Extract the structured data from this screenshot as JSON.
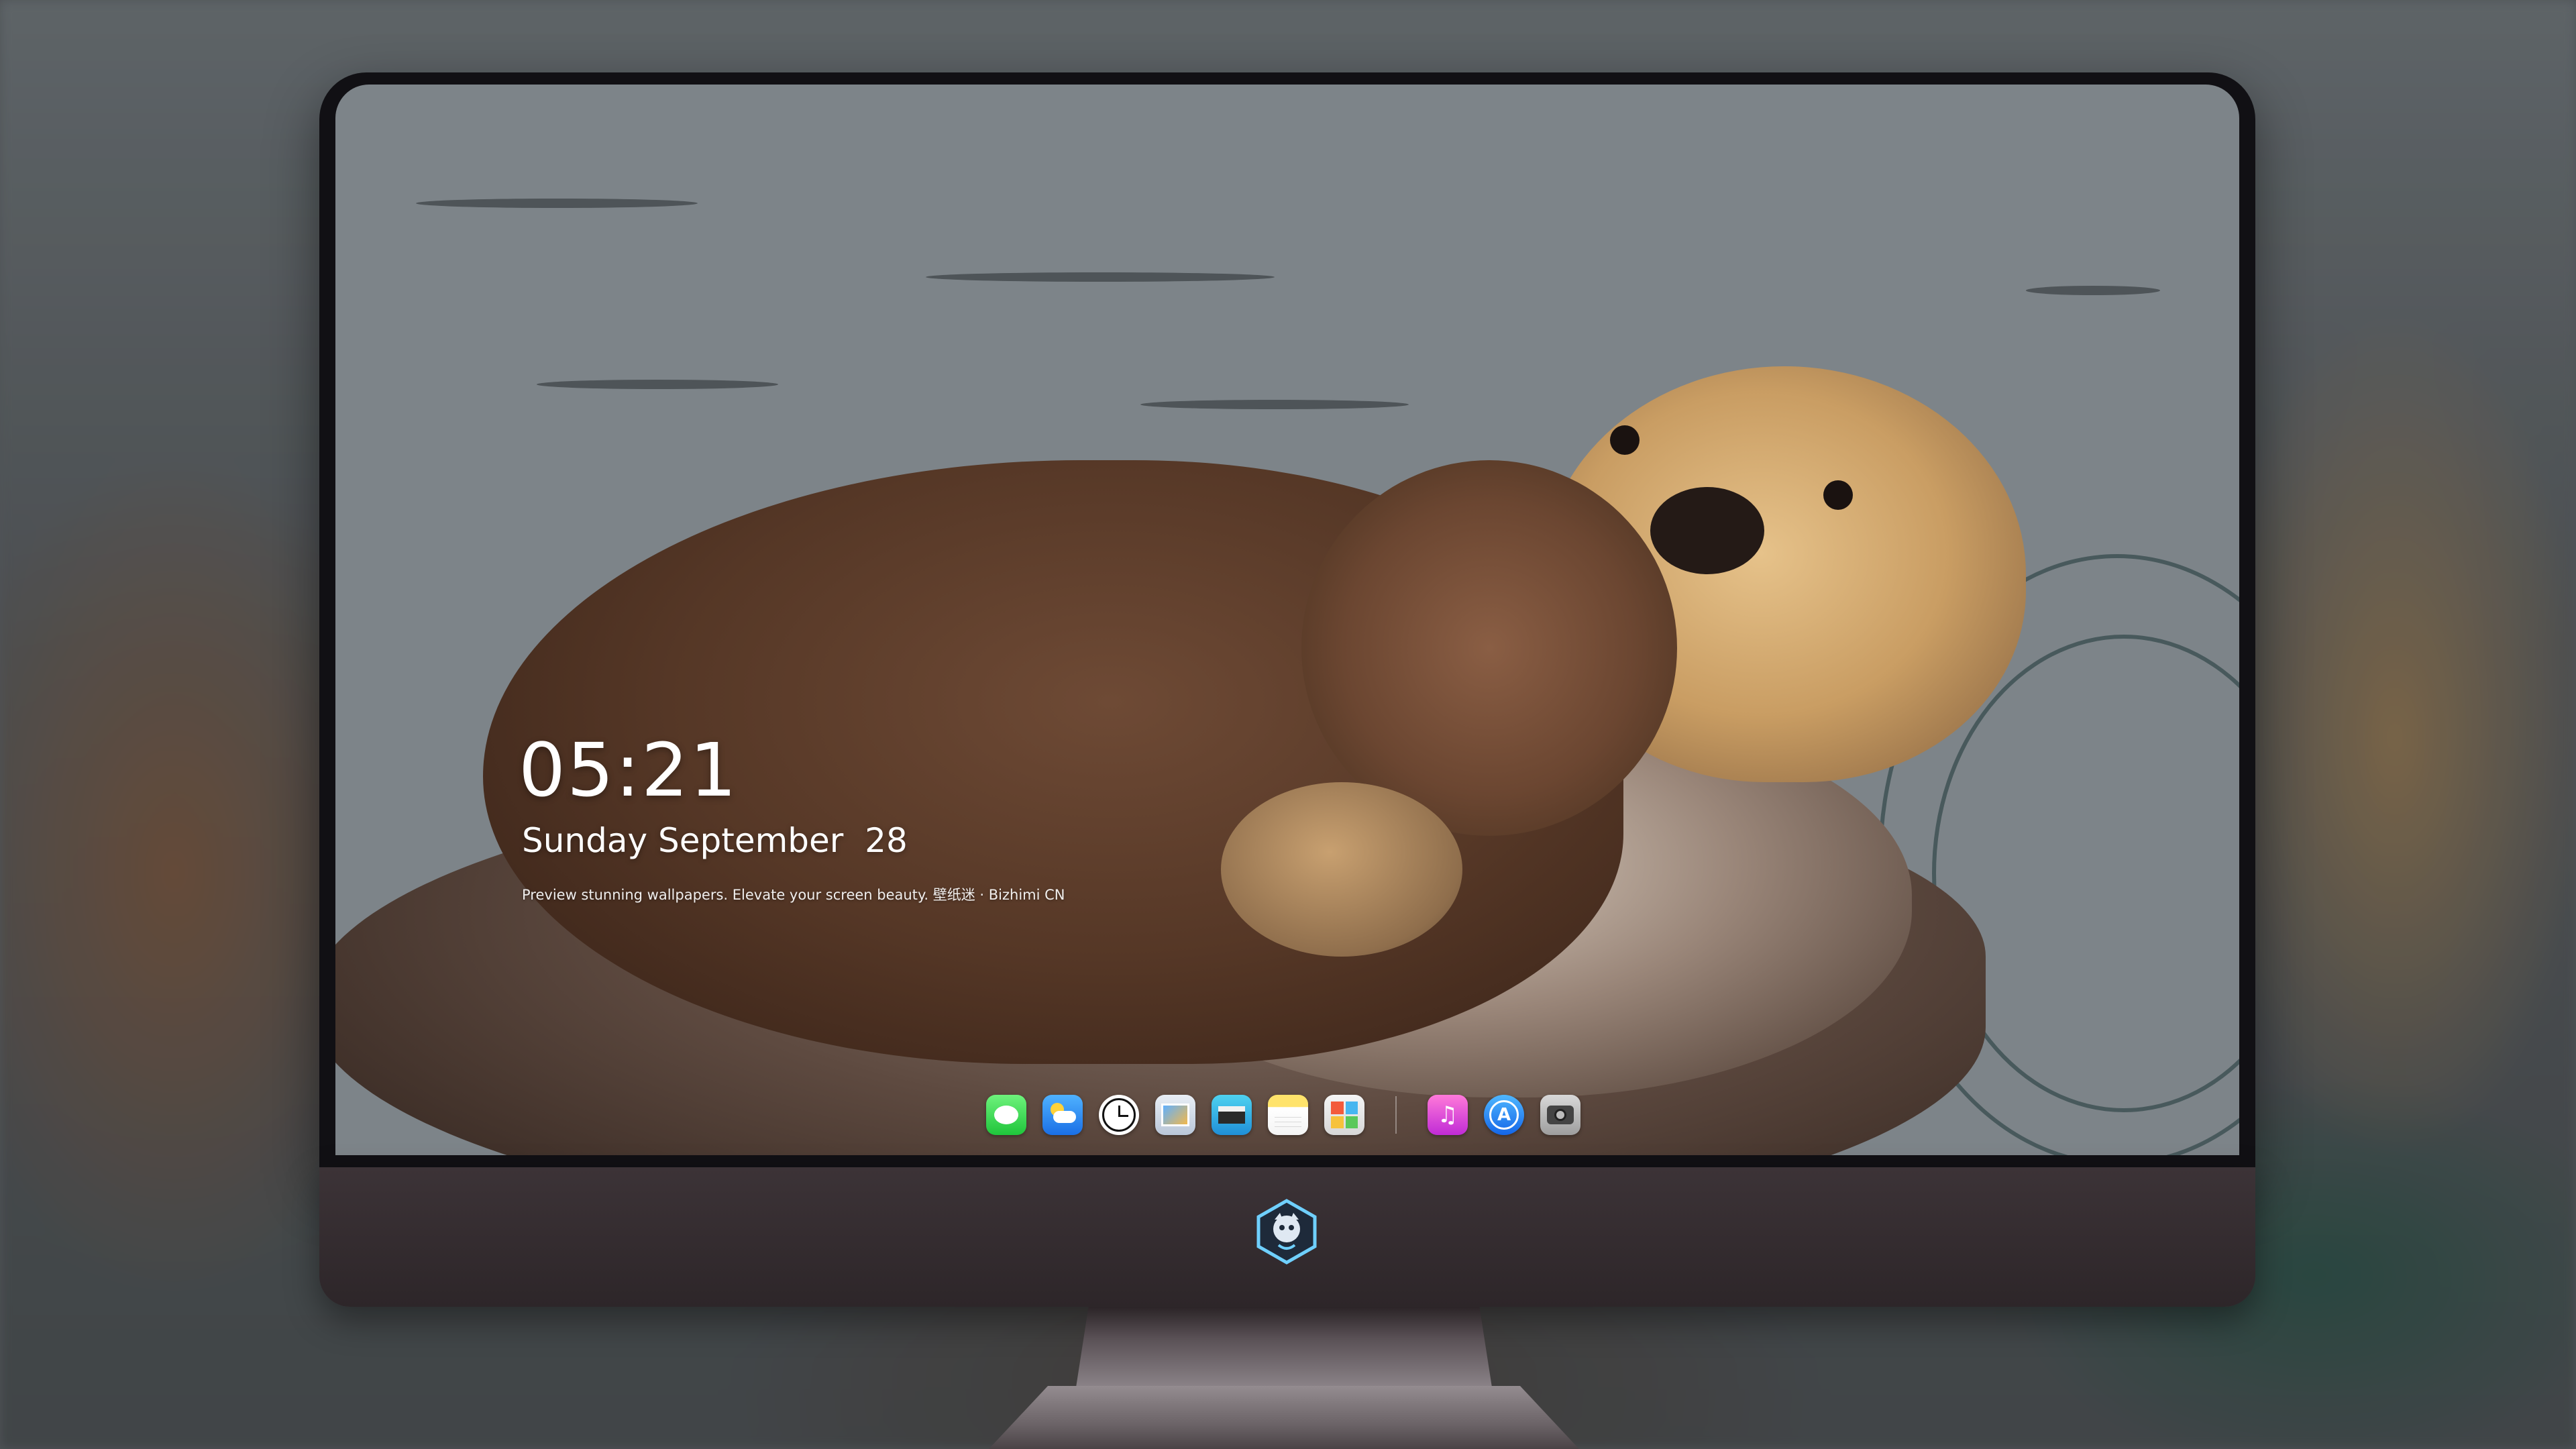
{
  "lock_screen": {
    "time": "05:21",
    "date": "Sunday September  28",
    "caption": "Preview stunning wallpapers. Elevate your screen beauty. 壁纸迷 · Bizhimi CN"
  },
  "dock": {
    "apps": [
      {
        "name": "messages-icon"
      },
      {
        "name": "weather-icon"
      },
      {
        "name": "clock-icon"
      },
      {
        "name": "preview-icon"
      },
      {
        "name": "video-clapper-icon"
      },
      {
        "name": "notes-icon"
      },
      {
        "name": "photos-icon"
      },
      {
        "name": "music-icon"
      },
      {
        "name": "app-store-icon"
      },
      {
        "name": "camera-icon"
      }
    ]
  },
  "colors": {
    "bezel": "#111014",
    "chin": "#3c3337",
    "text": "#ffffff"
  }
}
